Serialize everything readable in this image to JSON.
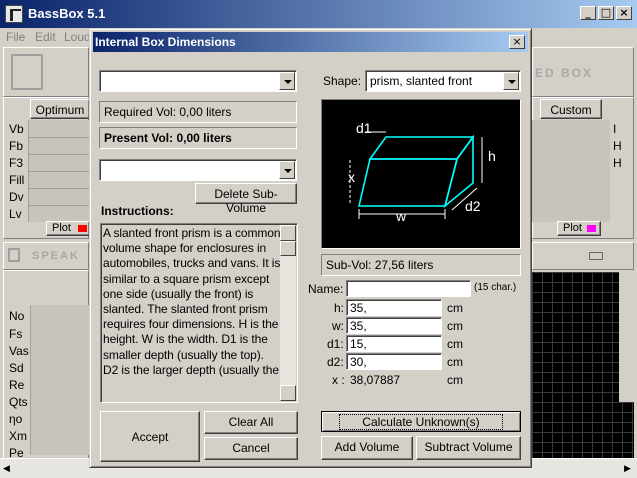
{
  "main": {
    "title": "BassBox 5.1",
    "menu": [
      "File",
      "Edit",
      "Loud"
    ],
    "right_banner": "ED BOX",
    "speaker_banner": "SPEAK",
    "optimum_button": "Optimum",
    "custom_button": "Custom",
    "box_params": [
      "Vb",
      "Fb",
      "F3",
      "Fill",
      "Dv",
      "Lv"
    ],
    "plot_label": "Plot",
    "speaker_params": [
      "No",
      "Fs",
      "Vas",
      "Sd",
      "Re",
      "Qts",
      "ηo",
      "Xm",
      "Pe"
    ],
    "right_letters": [
      "I",
      "H",
      "H"
    ]
  },
  "dialog": {
    "title": "Internal Box Dimensions",
    "close_label": "×",
    "top_combo_value": "",
    "required_vol": "Required Vol: 0,00 liters",
    "present_vol": "Present Vol: 0,00 liters",
    "subvol_combo_value": "",
    "delete_subvol": "Delete Sub-Volume",
    "instructions_label": "Instructions:",
    "instructions_text": "A slanted front prism is a common volume shape for enclosures in automobiles, trucks and vans. It is similar to a square prism except one side (usually the front) is slanted. The slanted front prism requires four dimensions. H is the height. W is the width. D1 is the smaller depth (usually the top). D2 is the larger depth (usually the",
    "shape_label": "Shape:",
    "shape_value": "prism, slanted front",
    "diagram_labels": {
      "d1": "d1",
      "h": "h",
      "x": "x",
      "w": "w",
      "d2": "d2"
    },
    "sub_vol": "Sub-Vol: 27,56 liters",
    "name_label": "Name:",
    "name_value": "",
    "name_hint": "(15 char.)",
    "dims": [
      {
        "label": "h:",
        "value": "35,",
        "unit": "cm"
      },
      {
        "label": "w:",
        "value": "35,",
        "unit": "cm"
      },
      {
        "label": "d1:",
        "value": "15,",
        "unit": "cm"
      },
      {
        "label": "d2:",
        "value": "30,",
        "unit": "cm"
      }
    ],
    "x_label": "x :",
    "x_value": "38,07887",
    "x_unit": "cm",
    "accept": "Accept",
    "clear_all": "Clear All",
    "cancel": "Cancel",
    "calculate": "Calculate Unknown(s)",
    "add_volume": "Add Volume",
    "subtract_volume": "Subtract Volume"
  },
  "colors": {
    "title_bar": "#0a246a",
    "diagram_bg": "#000000",
    "diagram_lines": "#00ffff",
    "diagram_text": "#ffffff",
    "plot_swatch_left": "#ff0000",
    "plot_swatch_right": "#ff00ff"
  }
}
